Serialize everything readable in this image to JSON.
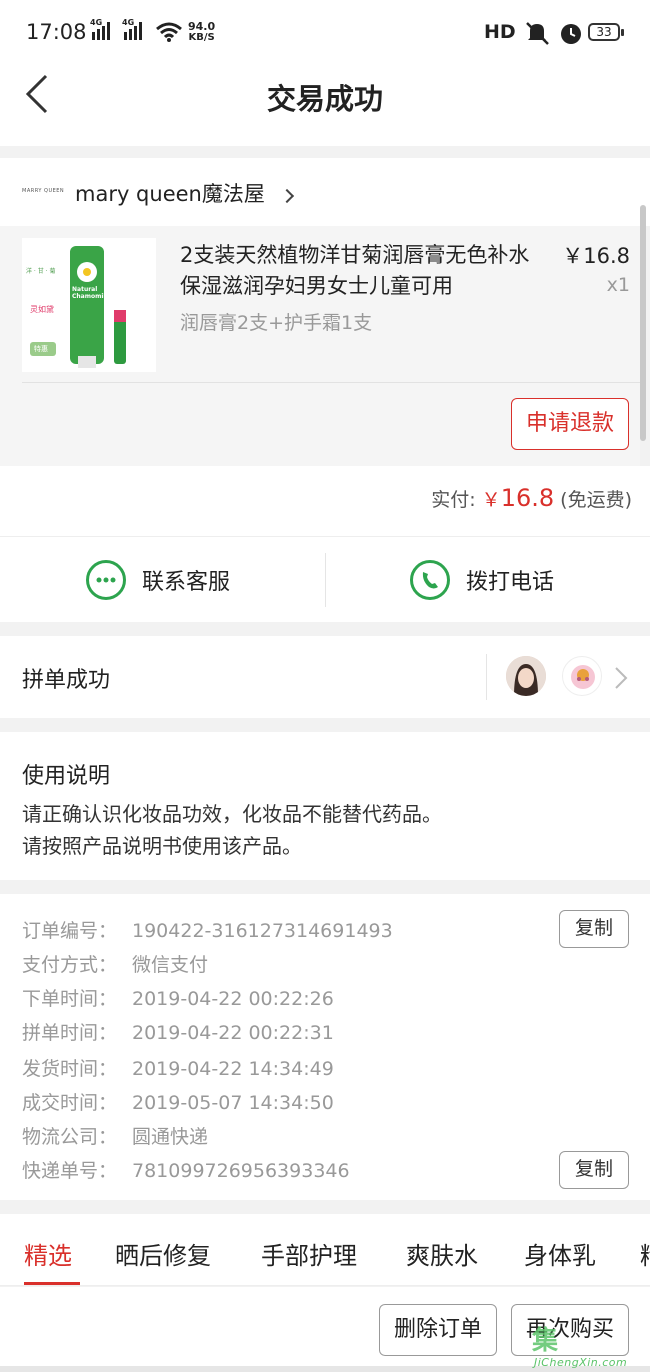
{
  "status_bar": {
    "time": "17:08",
    "signal1": "4G",
    "signal2": "4G",
    "net_speed_value": "94.0",
    "net_speed_unit": "KB/S",
    "hd": "HD",
    "battery": "33"
  },
  "header": {
    "title": "交易成功"
  },
  "shop": {
    "logo_text": "MARRY QUEEN",
    "name": "mary queen魔法屋"
  },
  "goods": {
    "title": "2支装天然植物洋甘菊润唇膏无色补水保湿滋润孕妇男女士儿童可用",
    "price": "￥16.8",
    "qty": "x1",
    "spec": "润唇膏2支+护手霜1支",
    "img_texts": {
      "top": "洋 · 甘 · 菊",
      "brand": "灵如黛",
      "badge": "特惠",
      "tube": "Natural Chamomile"
    }
  },
  "refund_label": "申请退款",
  "payment": {
    "label": "实付: ",
    "currency": "￥",
    "amount": "16.8",
    "note": " (免运费)"
  },
  "contact": {
    "service": "联系客服",
    "phone": "拨打电话"
  },
  "group": {
    "label": "拼单成功"
  },
  "usage": {
    "title": "使用说明",
    "line1": "请正确认识化妆品功效，化妆品不能替代药品。",
    "line2": "请按照产品说明书使用该产品。"
  },
  "order_info": [
    {
      "key": "订单编号：",
      "value": "190422-316127314691493"
    },
    {
      "key": "支付方式：",
      "value": "微信支付"
    },
    {
      "key": "下单时间：",
      "value": "2019-04-22 00:22:26"
    },
    {
      "key": "拼单时间：",
      "value": "2019-04-22 00:22:31"
    },
    {
      "key": "发货时间：",
      "value": "2019-04-22 14:34:49"
    },
    {
      "key": "成交时间：",
      "value": "2019-05-07 14:34:50"
    },
    {
      "key": "物流公司：",
      "value": "圆通快递"
    },
    {
      "key": "快递单号：",
      "value": "781099726956393346"
    }
  ],
  "copy_label": "复制",
  "tabs": [
    "精选",
    "晒后修复",
    "手部护理",
    "爽肤水",
    "身体乳",
    "精"
  ],
  "bottom": {
    "delete": "删除订单",
    "rebuy": "再次购买"
  },
  "watermark": {
    "logo": "集",
    "text": "JiChengXin.com"
  },
  "colors": {
    "accent": "#d9302b",
    "green": "#2da44e"
  }
}
